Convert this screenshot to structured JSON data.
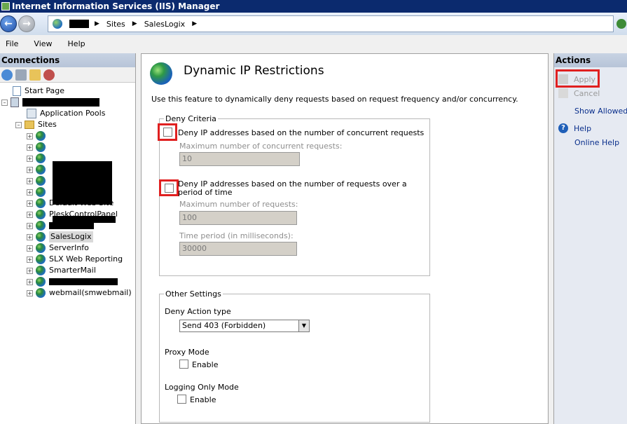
{
  "window": {
    "title": "Internet Information Services (IIS) Manager"
  },
  "address_bar": {
    "crumbs": [
      "Sites",
      "SalesLogix"
    ]
  },
  "menu": {
    "items": [
      "File",
      "View",
      "Help"
    ]
  },
  "connections": {
    "header": "Connections",
    "tree": {
      "start_page": "Start Page",
      "app_pools": "Application Pools",
      "sites": "Sites",
      "site_items": [
        "Default Web Site",
        "PleskControlPanel",
        "SalesLogix",
        "ServerInfo",
        "SLX Web Reporting",
        "SmarterMail",
        "webmail(smwebmail)"
      ],
      "selected": "SalesLogix"
    }
  },
  "main": {
    "title": "Dynamic IP Restrictions",
    "description": "Use this feature to dynamically deny requests based on request frequency and/or concurrency.",
    "deny_criteria": {
      "legend": "Deny Criteria",
      "concurrent": {
        "label": "Deny IP addresses based on the number of concurrent requests",
        "checked": false,
        "max_label": "Maximum number of concurrent requests:",
        "max_value": "10"
      },
      "over_time": {
        "label": "Deny IP addresses based on the number of requests over a period of time",
        "checked": false,
        "max_label": "Maximum number of requests:",
        "max_value": "100",
        "period_label": "Time period (in milliseconds):",
        "period_value": "30000"
      }
    },
    "other_settings": {
      "legend": "Other Settings",
      "deny_action_label": "Deny Action type",
      "deny_action_value": "Send 403 (Forbidden)",
      "proxy_mode_label": "Proxy Mode",
      "proxy_enable": "Enable",
      "logging_label": "Logging Only Mode",
      "logging_enable": "Enable"
    }
  },
  "actions": {
    "header": "Actions",
    "apply": "Apply",
    "cancel": "Cancel",
    "show_allowed": "Show Allowed A",
    "help": "Help",
    "online_help": "Online Help"
  },
  "colors": {
    "title_bar": "#0b2a6e",
    "highlight": "#e02020",
    "link": "#0a2f8c"
  }
}
